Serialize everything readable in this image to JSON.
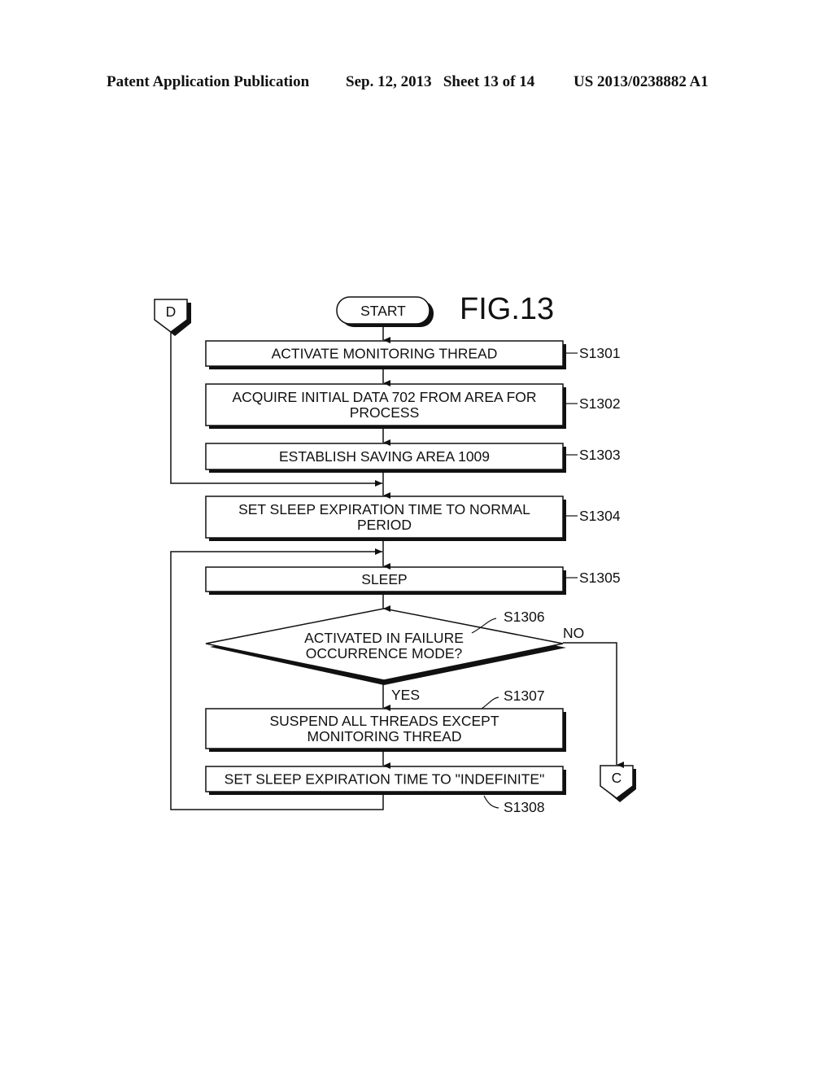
{
  "header": {
    "publication": "Patent Application Publication",
    "date_sheet": "Sep. 12, 2013   Sheet 13 of 14",
    "patent_number": "US 2013/0238882 A1"
  },
  "figure": {
    "title": "FIG.13",
    "start": "START",
    "connector_in": "D",
    "connector_out": "C",
    "steps": [
      {
        "id": "S1301",
        "lines": [
          "ACTIVATE MONITORING THREAD"
        ]
      },
      {
        "id": "S1302",
        "lines": [
          "ACQUIRE INITIAL DATA 702 FROM AREA FOR",
          "PROCESS"
        ]
      },
      {
        "id": "S1303",
        "lines": [
          "ESTABLISH SAVING AREA 1009"
        ]
      },
      {
        "id": "S1304",
        "lines": [
          "SET SLEEP EXPIRATION TIME TO NORMAL",
          "PERIOD"
        ]
      },
      {
        "id": "S1305",
        "lines": [
          "SLEEP"
        ]
      },
      {
        "id": "S1307",
        "lines": [
          "SUSPEND ALL THREADS EXCEPT",
          "MONITORING THREAD"
        ]
      },
      {
        "id": "S1308",
        "lines": [
          "SET SLEEP EXPIRATION TIME TO \"INDEFINITE\""
        ]
      }
    ],
    "decision": {
      "id": "S1306",
      "lines": [
        "ACTIVATED IN FAILURE",
        "OCCURRENCE MODE?"
      ],
      "yes": "YES",
      "no": "NO"
    }
  }
}
